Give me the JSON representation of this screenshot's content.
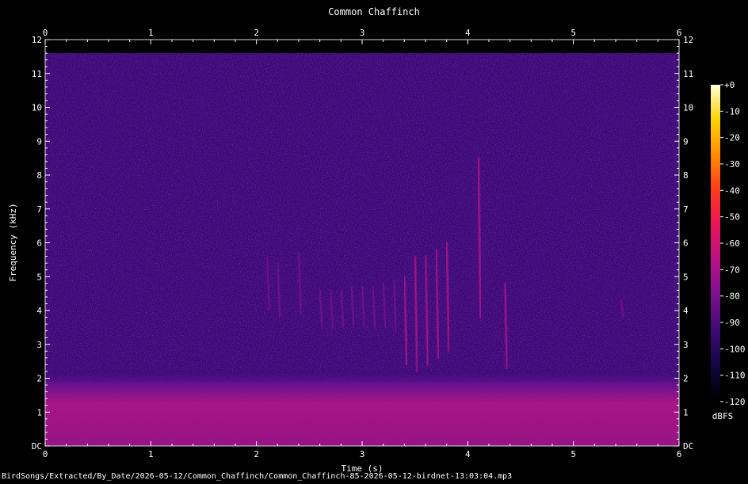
{
  "chart_data": {
    "type": "heatmap",
    "title": "Common Chaffinch",
    "xlabel": "Time (s)",
    "ylabel": "Frequency (kHz)",
    "xlim": [
      0,
      6
    ],
    "ylim": [
      0,
      12
    ],
    "x_ticks": [
      "0",
      "1",
      "2",
      "3",
      "4",
      "5",
      "6"
    ],
    "y_ticks": [
      "DC",
      "1",
      "2",
      "3",
      "4",
      "5",
      "6",
      "7",
      "8",
      "9",
      "10",
      "11",
      "12"
    ],
    "colorbar": {
      "label": "dBFS",
      "range": [
        -120,
        0
      ],
      "ticks": [
        "+0",
        "-10",
        "-20",
        "-30",
        "-40",
        "-50",
        "-60",
        "-70",
        "-80",
        "-90",
        "-100",
        "-110",
        "-120"
      ],
      "colors": [
        "#000000",
        "#12063f",
        "#3d0a78",
        "#7a1090",
        "#b81287",
        "#e8145a",
        "#ff3a1c",
        "#ff8a00",
        "#ffd200",
        "#ffffd8"
      ]
    },
    "background_level_dbfs": -100,
    "low_band": {
      "freq_khz": [
        0,
        2.3
      ],
      "level_dbfs": -62
    },
    "song_syllables": [
      {
        "t": 2.1,
        "f_low": 4.0,
        "f_high": 5.6,
        "level_dbfs": -80
      },
      {
        "t": 2.2,
        "f_low": 3.8,
        "f_high": 5.4,
        "level_dbfs": -80
      },
      {
        "t": 2.4,
        "f_low": 3.9,
        "f_high": 5.7,
        "level_dbfs": -80
      },
      {
        "t": 2.6,
        "f_low": 3.5,
        "f_high": 4.6,
        "level_dbfs": -75
      },
      {
        "t": 2.7,
        "f_low": 3.5,
        "f_high": 4.6,
        "level_dbfs": -75
      },
      {
        "t": 2.8,
        "f_low": 3.5,
        "f_high": 4.6,
        "level_dbfs": -75
      },
      {
        "t": 2.9,
        "f_low": 3.5,
        "f_high": 4.7,
        "level_dbfs": -75
      },
      {
        "t": 3.0,
        "f_low": 3.5,
        "f_high": 4.7,
        "level_dbfs": -75
      },
      {
        "t": 3.1,
        "f_low": 3.5,
        "f_high": 4.7,
        "level_dbfs": -75
      },
      {
        "t": 3.2,
        "f_low": 3.5,
        "f_high": 4.8,
        "level_dbfs": -75
      },
      {
        "t": 3.3,
        "f_low": 3.4,
        "f_high": 4.9,
        "level_dbfs": -75
      },
      {
        "t": 3.4,
        "f_low": 2.4,
        "f_high": 5.0,
        "level_dbfs": -72
      },
      {
        "t": 3.5,
        "f_low": 2.2,
        "f_high": 5.6,
        "level_dbfs": -72
      },
      {
        "t": 3.6,
        "f_low": 2.4,
        "f_high": 5.6,
        "level_dbfs": -72
      },
      {
        "t": 3.7,
        "f_low": 2.6,
        "f_high": 5.8,
        "level_dbfs": -72
      },
      {
        "t": 3.8,
        "f_low": 2.8,
        "f_high": 6.0,
        "level_dbfs": -72
      },
      {
        "t": 4.1,
        "f_low": 3.8,
        "f_high": 8.5,
        "level_dbfs": -70
      },
      {
        "t": 4.35,
        "f_low": 2.3,
        "f_high": 4.8,
        "level_dbfs": -65
      },
      {
        "t": 5.45,
        "f_low": 3.8,
        "f_high": 4.3,
        "level_dbfs": -80
      }
    ],
    "grid": false
  },
  "footer": {
    "filename": "BirdSongs/Extracted/By_Date/2026-05-12/Common_Chaffinch/Common_Chaffinch-85-2026-05-12-birdnet-13:03:04.mp3"
  }
}
